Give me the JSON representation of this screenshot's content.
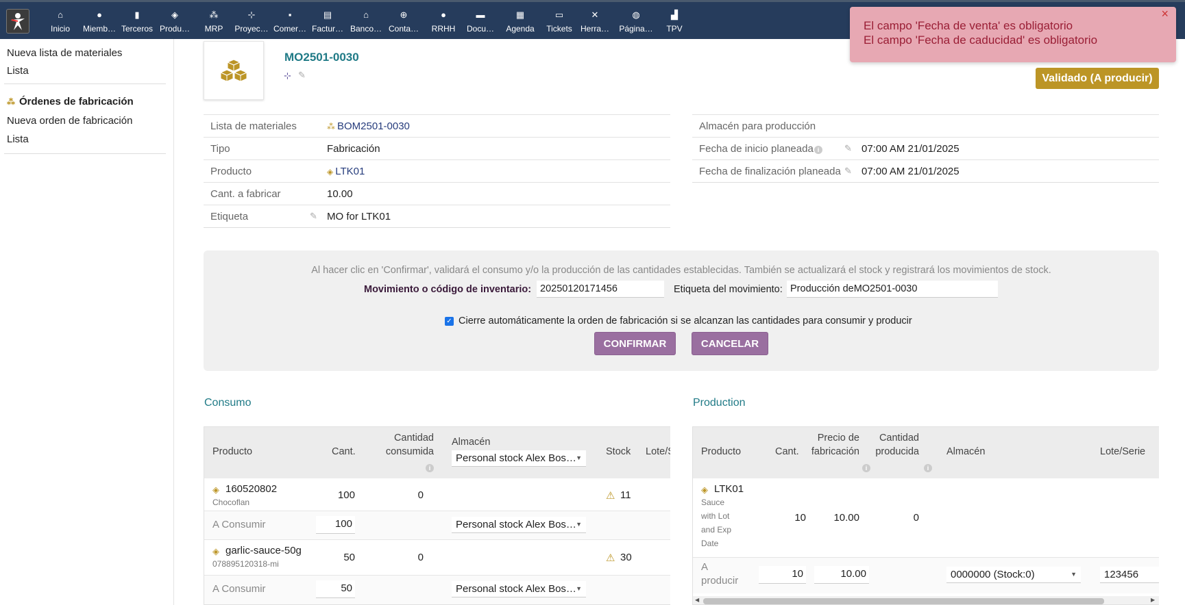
{
  "menu": [
    {
      "label": "Inicio",
      "icon": "home-icon",
      "glyph": "⌂"
    },
    {
      "label": "Miemb…",
      "icon": "user-icon",
      "glyph": "●"
    },
    {
      "label": "Terceros",
      "icon": "building-icon",
      "glyph": "▮"
    },
    {
      "label": "Produ…",
      "icon": "cube-icon",
      "glyph": "◈"
    },
    {
      "label": "MRP",
      "icon": "cubes-icon",
      "glyph": "⁂"
    },
    {
      "label": "Proyec…",
      "icon": "sitemap-icon",
      "glyph": "⊹"
    },
    {
      "label": "Comer…",
      "icon": "briefcase-icon",
      "glyph": "▪"
    },
    {
      "label": "Factur…",
      "icon": "file-icon",
      "glyph": "▤"
    },
    {
      "label": "Banco…",
      "icon": "bank-icon",
      "glyph": "⌂"
    },
    {
      "label": "Conta…",
      "icon": "search-dollar-icon",
      "glyph": "⊕"
    },
    {
      "label": "RRHH",
      "icon": "user-tie-icon",
      "glyph": "●"
    },
    {
      "label": "Docu…",
      "icon": "folder-icon",
      "glyph": "▬"
    },
    {
      "label": "Agenda",
      "icon": "calendar-icon",
      "glyph": "▦"
    },
    {
      "label": "Tickets",
      "icon": "ticket-icon",
      "glyph": "▭"
    },
    {
      "label": "Herra…",
      "icon": "tools-icon",
      "glyph": "✕"
    },
    {
      "label": "Página…",
      "icon": "globe-icon",
      "glyph": "◍"
    },
    {
      "label": "TPV",
      "icon": "cash-register-icon",
      "glyph": "▟"
    }
  ],
  "left": {
    "bom_new": "Nueva lista de materiales",
    "bom_list": "Lista",
    "mo_title": "Órdenes de fabricación",
    "mo_new": "Nueva orden de fabricación",
    "mo_list": "Lista"
  },
  "header": {
    "ref": "MO2501-0030",
    "status": "Validado (A producir)"
  },
  "fields_left": [
    {
      "label": "Lista de materiales",
      "value": "BOM2501-0030"
    },
    {
      "label": "Tipo",
      "value": "Fabricación"
    },
    {
      "label": "Producto",
      "value": "LTK01"
    },
    {
      "label": "Cant. a fabricar",
      "value": "10.00"
    },
    {
      "label": "Etiqueta",
      "value": "MO for LTK01"
    }
  ],
  "fields_right": [
    {
      "label": "Almacén para producción",
      "value": ""
    },
    {
      "label": "Fecha de inicio planeada",
      "value": "07:00 AM 21/01/2025"
    },
    {
      "label": "Fecha de finalización planeada",
      "value": "07:00 AM 21/01/2025"
    }
  ],
  "confirm": {
    "info": "Al hacer clic en 'Confirmar', validará el consumo y/o la producción de las cantidades establecidas. También se actualizará el stock y registrará los movimientos de stock.",
    "code_label": "Movimiento o código de inventario:",
    "code_value": "20250120171456",
    "mvt_label": "Etiqueta del movimiento:",
    "mvt_value": "Producción deMO2501-0030",
    "auto_close": "Cierre automáticamente la orden de fabricación si se alcanzan las cantidades para consumir y producir",
    "confirm_btn": "CONFIRMAR",
    "cancel_btn": "CANCELAR"
  },
  "consumo": {
    "title": "Consumo",
    "headers": {
      "product": "Producto",
      "qty": "Cant.",
      "consumed_1": "Cantidad",
      "consumed_2": "consumida",
      "warehouse": "Almacén",
      "warehouse_select": "Personal stock Alex Bos…",
      "stock": "Stock",
      "lot": "Lote/S"
    },
    "rows": [
      {
        "product": "160520802",
        "desc": "Chocoflan",
        "qty": "100",
        "consumed": "0",
        "stock": "11",
        "to_label": "A Consumir",
        "to_qty": "100",
        "to_wh": "Personal stock Alex Bos…"
      },
      {
        "product": "garlic-sauce-50g",
        "desc": "078895120318-mi",
        "qty": "50",
        "consumed": "0",
        "stock": "30",
        "to_label": "A Consumir",
        "to_qty": "50",
        "to_wh": "Personal stock Alex Bos…"
      }
    ]
  },
  "production": {
    "title": "Production",
    "headers": {
      "product": "Producto",
      "qty": "Cant.",
      "price_1": "Precio de",
      "price_2": "fabricación",
      "produced_1": "Cantidad",
      "produced_2": "producida",
      "warehouse": "Almacén",
      "lot": "Lote/Serie"
    },
    "row": {
      "product": "LTK01",
      "desc": [
        "Sauce",
        "with Lot",
        "and Exp",
        "Date"
      ],
      "qty": "10",
      "price": "10.00",
      "produced": "0"
    },
    "to": {
      "label_1": "A",
      "label_2": "producir",
      "qty": "10",
      "price": "10.00",
      "warehouse": "0000000 (Stock:0)",
      "lot": "123456"
    }
  },
  "toast": {
    "line1": "El campo 'Fecha de venta' es obligatorio",
    "line2": "El campo 'Fecha de caducidad' es obligatorio",
    "close": "×"
  },
  "colors": {
    "topbar": "#263c5c",
    "accent": "#1f7a86",
    "status": "#bc9526",
    "button": "#9a6fa0",
    "toast": "#e7a8b3"
  }
}
